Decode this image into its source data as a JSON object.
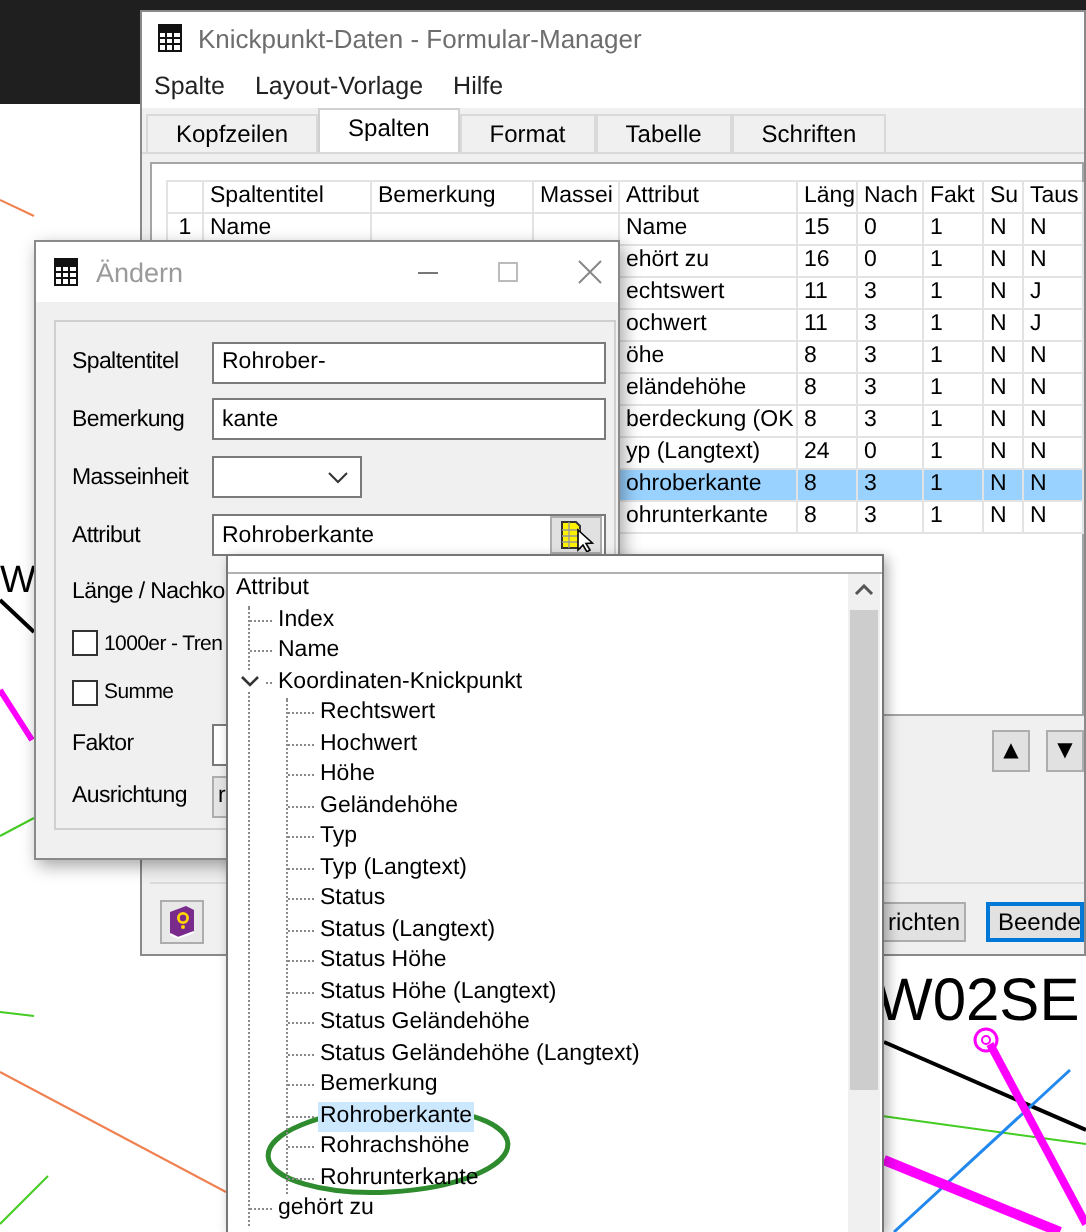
{
  "desktop": {
    "labels": [
      "W",
      "W02SE"
    ]
  },
  "main_window": {
    "title": "Knickpunkt-Daten - Formular-Manager",
    "menu": [
      "Spalte",
      "Layout-Vorlage",
      "Hilfe"
    ],
    "tabs": [
      {
        "label": "Kopfzeilen",
        "selected": false
      },
      {
        "label": "Spalten",
        "selected": true
      },
      {
        "label": "Format",
        "selected": false
      },
      {
        "label": "Tabelle",
        "selected": false
      },
      {
        "label": "Schriften",
        "selected": false
      }
    ],
    "table": {
      "columns": [
        "Spaltentitel",
        "Bemerkung",
        "Massei",
        "Attribut",
        "Läng",
        "Nach",
        "Fakt",
        "Su",
        "Taus"
      ],
      "rows": [
        {
          "number": "1",
          "title": "Name",
          "attribute": "Name",
          "values": [
            "15",
            "0",
            "1",
            "N",
            "N"
          ],
          "selected": false
        },
        {
          "attribute": "ehört zu",
          "values": [
            "16",
            "0",
            "1",
            "N",
            "N"
          ],
          "selected": false
        },
        {
          "attribute": "echtswert",
          "values": [
            "11",
            "3",
            "1",
            "N",
            "J"
          ],
          "selected": false
        },
        {
          "attribute": "ochwert",
          "values": [
            "11",
            "3",
            "1",
            "N",
            "J"
          ],
          "selected": false
        },
        {
          "attribute": "öhe",
          "values": [
            "8",
            "3",
            "1",
            "N",
            "N"
          ],
          "selected": false
        },
        {
          "attribute": "eländehöhe",
          "values": [
            "8",
            "3",
            "1",
            "N",
            "N"
          ],
          "selected": false
        },
        {
          "attribute": "berdeckung (OK",
          "values": [
            "8",
            "3",
            "1",
            "N",
            "N"
          ],
          "selected": false
        },
        {
          "attribute": "yp (Langtext)",
          "values": [
            "24",
            "0",
            "1",
            "N",
            "N"
          ],
          "selected": false
        },
        {
          "attribute": "ohroberkante",
          "values": [
            "8",
            "3",
            "1",
            "N",
            "N"
          ],
          "selected": true
        },
        {
          "attribute": "ohrunterkante",
          "values": [
            "8",
            "3",
            "1",
            "N",
            "N"
          ],
          "selected": false
        }
      ]
    },
    "order_buttons": [
      "▲",
      "▼"
    ],
    "buttons": [
      {
        "label": "richten",
        "default": false
      },
      {
        "label": "Beende",
        "default": true
      }
    ]
  },
  "dialog": {
    "title": "Ändern",
    "fields": [
      {
        "kind": "text",
        "label": "Spaltentitel",
        "value": "Rohrober-"
      },
      {
        "kind": "text",
        "label": "Bemerkung",
        "value": "kante"
      },
      {
        "kind": "combo",
        "label": "Masseinheit"
      },
      {
        "kind": "picker",
        "label": "Attribut",
        "value": "Rohroberkante"
      },
      {
        "kind": "label",
        "label": "Länge / Nachko"
      },
      {
        "kind": "checkbox",
        "label": "1000er - Tren",
        "checked": false
      },
      {
        "kind": "checkbox",
        "label": "Summe",
        "checked": false
      },
      {
        "kind": "text",
        "label": "Faktor"
      },
      {
        "kind": "select",
        "label": "Ausrichtung",
        "value": "r"
      }
    ]
  },
  "popup": {
    "root": "Attribut",
    "items": [
      {
        "label": "Index",
        "selected": false
      },
      {
        "label": "Name",
        "selected": false
      },
      {
        "label": "Koordinaten-Knickpunkt",
        "selected": false,
        "expanded": true,
        "children": [
          {
            "label": "Rechtswert",
            "selected": false
          },
          {
            "label": "Hochwert",
            "selected": false
          },
          {
            "label": "Höhe",
            "selected": false
          },
          {
            "label": "Geländehöhe",
            "selected": false
          },
          {
            "label": "Typ",
            "selected": false
          },
          {
            "label": "Typ (Langtext)",
            "selected": false
          },
          {
            "label": "Status",
            "selected": false
          },
          {
            "label": "Status (Langtext)",
            "selected": false
          },
          {
            "label": "Status Höhe",
            "selected": false
          },
          {
            "label": "Status Höhe (Langtext)",
            "selected": false
          },
          {
            "label": "Status Geländehöhe",
            "selected": false
          },
          {
            "label": "Status Geländehöhe (Langtext)",
            "selected": false
          },
          {
            "label": "Bemerkung",
            "selected": false
          },
          {
            "label": "Rohroberkante",
            "selected": true
          },
          {
            "label": "Rohrachshöhe",
            "selected": false
          },
          {
            "label": "Rohrunterkante",
            "selected": false
          }
        ]
      },
      {
        "label": "gehört zu",
        "selected": false
      }
    ]
  }
}
